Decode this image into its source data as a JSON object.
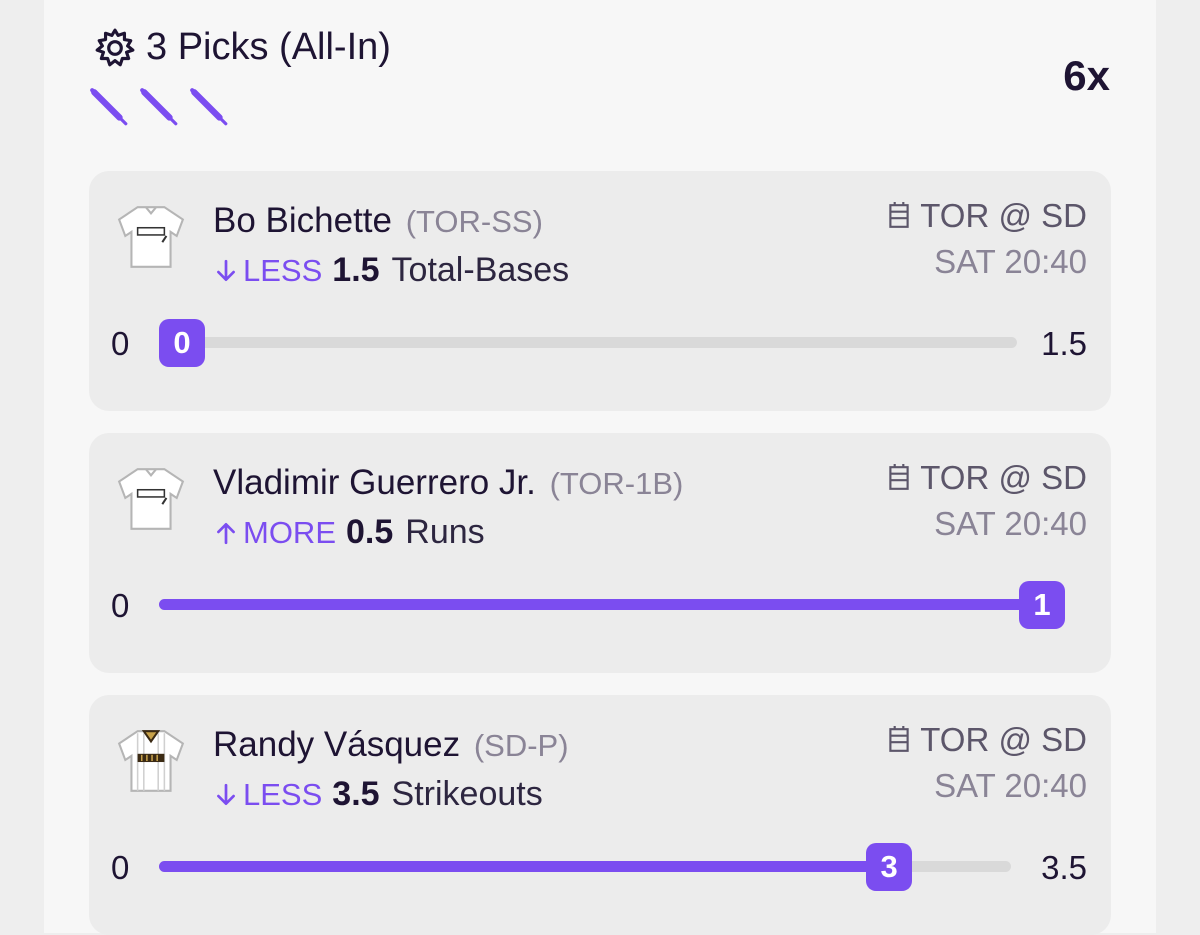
{
  "header": {
    "title": "3 Picks (All-In)",
    "multiplier": "6x",
    "bat_icons": [
      "baseball-bat-icon",
      "baseball-bat-icon",
      "baseball-bat-icon"
    ]
  },
  "colors": {
    "accent": "#7b4df0",
    "text": "#1e1433",
    "muted": "#8a8496"
  },
  "picks": [
    {
      "player": "Bo Bichette",
      "team_pos": "(TOR-SS)",
      "direction": "LESS",
      "direction_icon": "arrow-down-icon",
      "line": "1.5",
      "stat": "Total-Bases",
      "matchup": "TOR @ SD",
      "time": "SAT 20:40",
      "scale_min": "0",
      "scale_max": "1.5",
      "current": "0",
      "progress": 0,
      "show_max": true
    },
    {
      "player": "Vladimir Guerrero Jr.",
      "team_pos": "(TOR-1B)",
      "direction": "MORE",
      "direction_icon": "arrow-up-icon",
      "line": "0.5",
      "stat": "Runs",
      "matchup": "TOR @ SD",
      "time": "SAT 20:40",
      "scale_min": "0",
      "scale_max": "",
      "current": "1",
      "progress": 1,
      "show_max": false
    },
    {
      "player": "Randy Vásquez",
      "team_pos": "(SD-P)",
      "direction": "LESS",
      "direction_icon": "arrow-down-icon",
      "line": "3.5",
      "stat": "Strikeouts",
      "matchup": "TOR @ SD",
      "time": "SAT 20:40",
      "scale_min": "0",
      "scale_max": "3.5",
      "current": "3",
      "progress": 0.857,
      "show_max": true
    }
  ]
}
